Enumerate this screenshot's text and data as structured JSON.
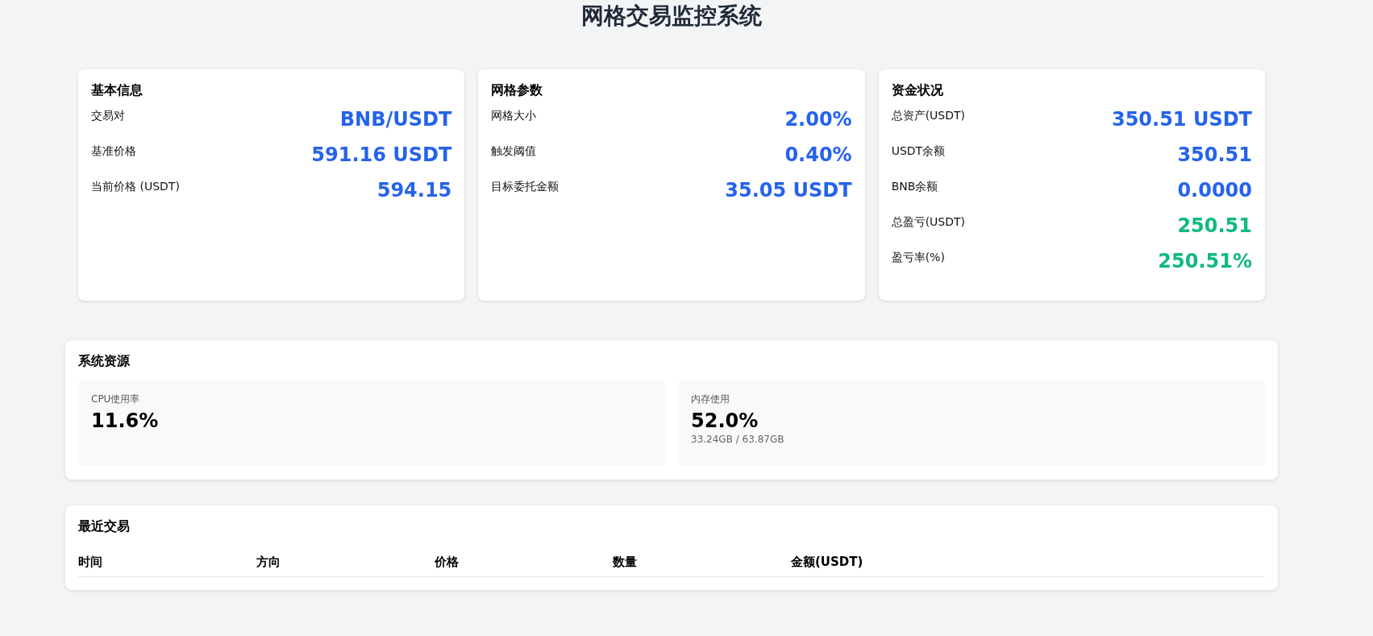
{
  "title": "网格交易监控系统",
  "cards": [
    {
      "heading": "基本信息",
      "rows": [
        {
          "label": "交易对",
          "value": "BNB/USDT",
          "color": "#2563eb"
        },
        {
          "label": "基准价格",
          "value": "591.16 USDT",
          "color": "#2563eb"
        },
        {
          "label": "当前价格 (USDT)",
          "value": "594.15",
          "color": "#2563eb"
        }
      ]
    },
    {
      "heading": "网格参数",
      "rows": [
        {
          "label": "网格大小",
          "value": "2.00%",
          "color": "#2563eb"
        },
        {
          "label": "触发阈值",
          "value": "0.40%",
          "color": "#2563eb"
        },
        {
          "label": "目标委托金额",
          "value": "35.05 USDT",
          "color": "#2563eb"
        }
      ]
    },
    {
      "heading": "资金状况",
      "rows": [
        {
          "label": "总资产(USDT)",
          "value": "350.51 USDT",
          "color": "#2563eb"
        },
        {
          "label": "USDT余额",
          "value": "350.51",
          "color": "#2563eb"
        },
        {
          "label": "BNB余额",
          "value": "0.0000",
          "color": "#2563eb"
        },
        {
          "label": "总盈亏(USDT)",
          "value": "250.51",
          "color": "#10b981"
        },
        {
          "label": "盈亏率(%)",
          "value": "250.51%",
          "color": "#10b981"
        }
      ]
    }
  ],
  "system": {
    "heading": "系统资源",
    "metrics": [
      {
        "label": "CPU使用率",
        "value": "11.6%"
      },
      {
        "label": "内存使用",
        "value": "52.0%",
        "detail": "33.24GB / 63.87GB"
      }
    ]
  },
  "trades": {
    "heading": "最近交易",
    "columns": [
      "时间",
      "方向",
      "价格",
      "数量",
      "金额(USDT)"
    ]
  }
}
